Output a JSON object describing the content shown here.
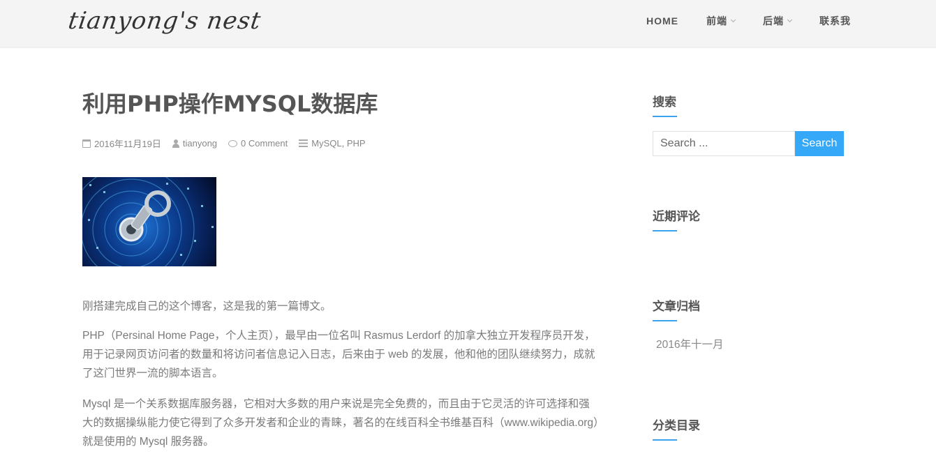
{
  "header": {
    "logo": "tianyong's nest",
    "nav": [
      {
        "label": "HOME",
        "dropdown": false
      },
      {
        "label": "前端",
        "dropdown": true
      },
      {
        "label": "后端",
        "dropdown": true
      },
      {
        "label": "联系我",
        "dropdown": false
      }
    ]
  },
  "post": {
    "title": "利用PHP操作MYSQL数据库",
    "date": "2016年11月19日",
    "author": "tianyong",
    "comments": "0 Comment",
    "categories": "MySQL, PHP",
    "paragraphs": [
      "刚搭建完成自己的这个博客，这是我的第一篇博文。",
      "PHP（Persinal Home Page，个人主页），最早由一位名叫 Rasmus Lerdorf 的加拿大独立开发程序员开发，用于记录网页访问者的数量和将访问者信息记入日志，后来由于 web 的发展，他和他的团队继续努力，成就了这门世界一流的脚本语言。",
      "Mysql 是一个关系数据库服务器，它相对大多数的用户来说是完全免费的，而且由于它灵活的许可选择和强大的数据操纵能力使它得到了众多开发者和企业的青睐，著名的在线百科全书维基百科（www.wikipedia.org）就是使用的 Mysql 服务器。"
    ]
  },
  "sidebar": {
    "search_title": "搜索",
    "search_placeholder": "Search ...",
    "search_button": "Search",
    "recent_comments_title": "近期评论",
    "archives_title": "文章归档",
    "archives": [
      "2016年十一月"
    ],
    "categories_title": "分类目录"
  },
  "colors": {
    "accent": "#35a8f7",
    "header_bg": "#f4f4f4",
    "title": "#555555",
    "body_text": "#7a7a7a"
  }
}
